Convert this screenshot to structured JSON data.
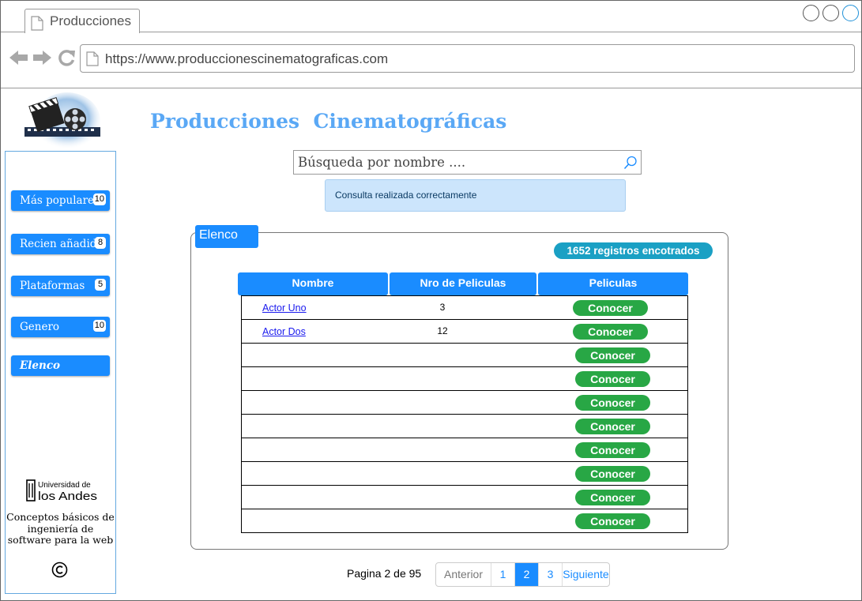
{
  "browser": {
    "tab_title": "Producciones",
    "url": "https://www.produccionescinematograficas.com"
  },
  "page": {
    "title": "Producciones  Cinematográficas"
  },
  "search": {
    "placeholder": "Búsqueda por nombre ...."
  },
  "alert": {
    "message": "Consulta realizada correctamente"
  },
  "sidebar": {
    "items": [
      {
        "label": "Más populares",
        "badge": "10",
        "active": false
      },
      {
        "label": "Recien añadida",
        "badge": "8",
        "active": false
      },
      {
        "label": "Plataformas",
        "badge": "5",
        "active": false
      },
      {
        "label": "Genero",
        "badge": "10",
        "active": false
      },
      {
        "label": "Elenco",
        "badge": "",
        "active": true
      }
    ],
    "footer": {
      "university_line1": "Universidad de",
      "university_line2": "los Andes",
      "course_text": "Conceptos básicos de ingeniería de software para la web"
    }
  },
  "panel": {
    "tab_label": "Elenco",
    "count_badge": "1652 registros encotrados",
    "columns": [
      "Nombre",
      "Nro de Peliculas",
      "Peliculas"
    ],
    "rows": [
      {
        "name": "Actor Uno",
        "count": "3",
        "action": "Conocer"
      },
      {
        "name": "Actor Dos",
        "count": "12",
        "action": "Conocer"
      },
      {
        "name": "",
        "count": "",
        "action": "Conocer"
      },
      {
        "name": "",
        "count": "",
        "action": "Conocer"
      },
      {
        "name": "",
        "count": "",
        "action": "Conocer"
      },
      {
        "name": "",
        "count": "",
        "action": "Conocer"
      },
      {
        "name": "",
        "count": "",
        "action": "Conocer"
      },
      {
        "name": "",
        "count": "",
        "action": "Conocer"
      },
      {
        "name": "",
        "count": "",
        "action": "Conocer"
      },
      {
        "name": "",
        "count": "",
        "action": "Conocer"
      }
    ]
  },
  "pagination": {
    "info": "Pagina 2 de 95",
    "prev": "Anterior",
    "pages": [
      "1",
      "2",
      "3"
    ],
    "current": "2",
    "next": "Siguiente"
  },
  "colors": {
    "primary": "#1a8cff",
    "title": "#5aa8f5",
    "success": "#28a745",
    "info_badge": "#1aa0c4",
    "alert_bg": "#cce5fc"
  }
}
